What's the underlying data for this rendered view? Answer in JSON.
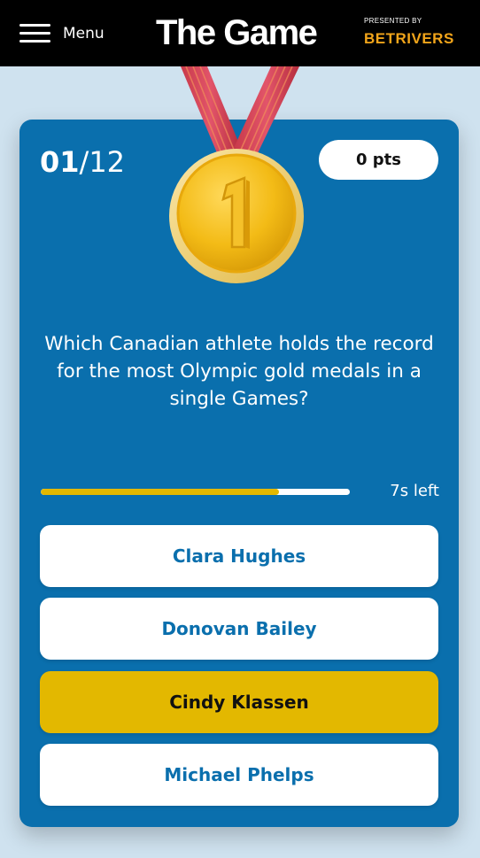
{
  "header": {
    "menu_label": "Menu",
    "title": "The Game",
    "sponsor_small": "PRESENTED BY",
    "sponsor_logo": "BETRIVERS",
    "background": "#000000"
  },
  "quiz": {
    "counter_current": "01",
    "counter_total": "/12",
    "points": "0 pts",
    "medal_icon": "gold-medal-number-one-icon",
    "question": "Which Canadian athlete holds the record for the most Olympic gold medals in a single Games?",
    "timer_text": "7s left",
    "timer_progress": 0.77,
    "answers": [
      {
        "label": "Clara Hughes",
        "selected": false
      },
      {
        "label": "Donovan Bailey",
        "selected": false
      },
      {
        "label": "Cindy Klassen",
        "selected": true
      },
      {
        "label": "Michael Phelps",
        "selected": false
      }
    ]
  },
  "colors": {
    "page_background": "#cfe2ef",
    "card": "#0a6fad",
    "accent_yellow": "#e3b800",
    "sponsor_orange": "#f2a51a"
  }
}
